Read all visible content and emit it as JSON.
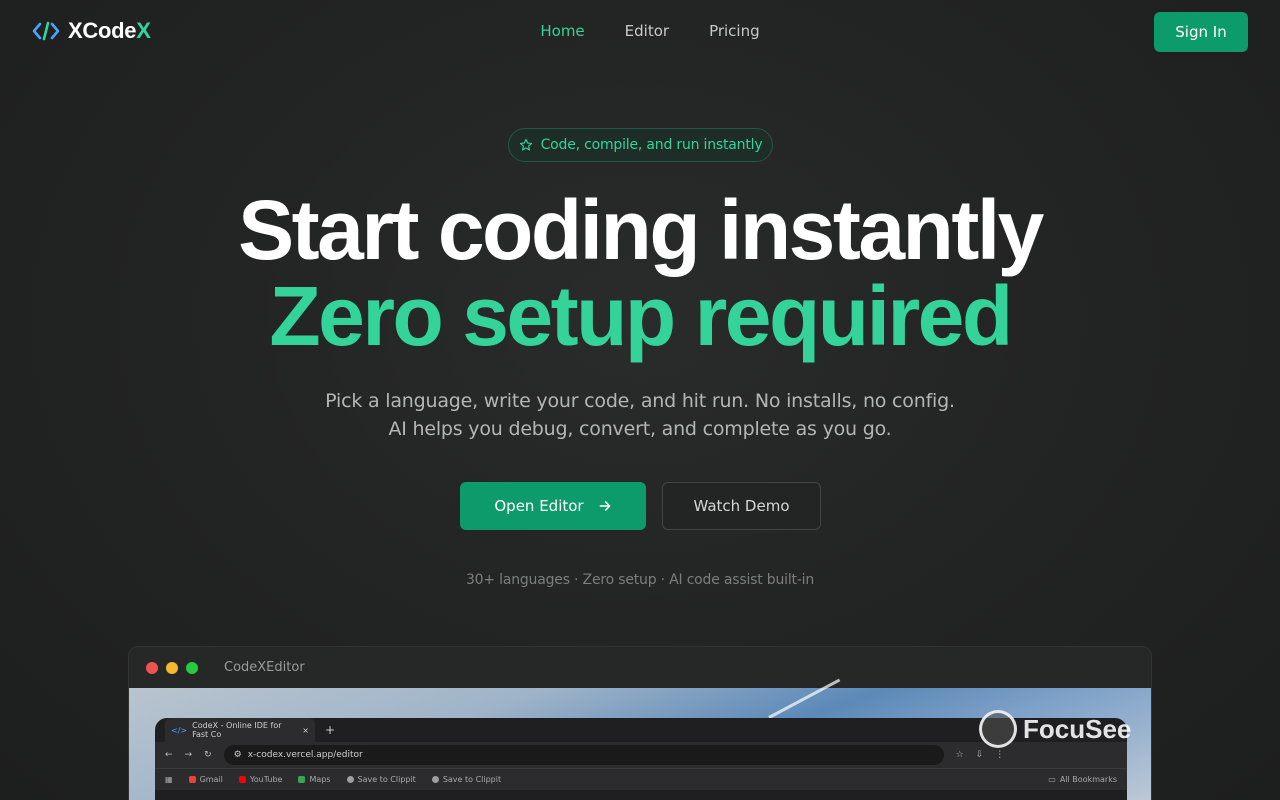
{
  "nav": {
    "logo_main": "XCode",
    "logo_accent": "X",
    "links": [
      {
        "label": "Home",
        "active": true
      },
      {
        "label": "Editor",
        "active": false
      },
      {
        "label": "Pricing",
        "active": false
      }
    ],
    "sign_in_label": "Sign In"
  },
  "hero": {
    "badge_text": "Code, compile, and run instantly",
    "headline_line1": "Start coding instantly",
    "headline_line2": "Zero setup required",
    "subtitle_line1": "Pick a language, write your code, and hit run. No installs, no config.",
    "subtitle_line2": "AI helps you debug, convert, and complete as you go.",
    "primary_cta": "Open Editor",
    "secondary_cta": "Watch Demo",
    "features": "30+ languages · Zero setup · AI code assist built-in"
  },
  "preview": {
    "window_title": "CodeXEditor",
    "browser_tab": "CodeX - Online IDE for Fast Co",
    "url": "x-codex.vercel.app/editor",
    "bookmarks": [
      "Gmail",
      "YouTube",
      "Maps",
      "Save to Clippit",
      "Save to Clippit"
    ],
    "all_bookmarks": "All Bookmarks",
    "watermark": "FocuSee"
  },
  "colors": {
    "accent": "#34d399",
    "button": "#0d9b6c",
    "background": "#232424"
  }
}
